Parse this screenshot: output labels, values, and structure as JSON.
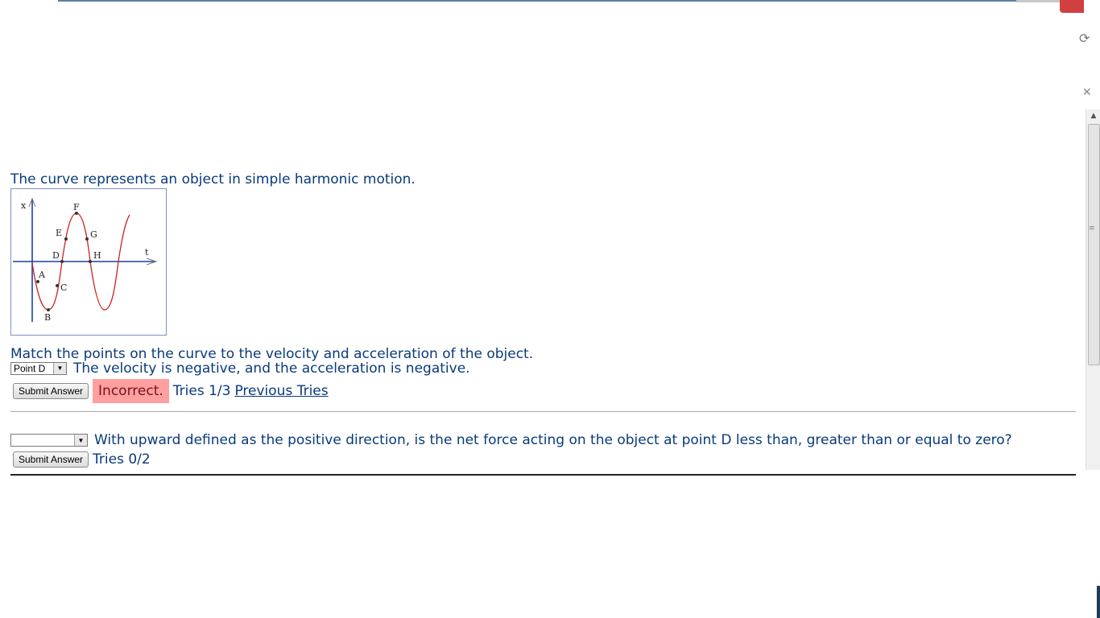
{
  "intro": "The curve represents an object in simple harmonic motion.",
  "figure": {
    "axis_x_label": "x",
    "axis_t_label": "t",
    "points": [
      "A",
      "B",
      "C",
      "D",
      "E",
      "F",
      "G",
      "H"
    ]
  },
  "question1": {
    "prompt": "Match the points on the curve to the velocity and acceleration of the object.",
    "select_value": "Point D",
    "statement": "The velocity is negative, and the acceleration is negative.",
    "submit_label": "Submit Answer",
    "result": "Incorrect.",
    "tries": "Tries 1/3",
    "previous_tries": "Previous Tries"
  },
  "question2": {
    "select_value": "",
    "prompt": "With upward defined as the positive direction, is the net force acting on the object at point D less than, greater than or equal to zero?",
    "submit_label": "Submit Answer",
    "tries": "Tries 0/2"
  },
  "colors": {
    "text": "#0a3a7a",
    "incorrect_bg": "#ff9f9f",
    "curve": "#cc2222",
    "axis": "#1c3fae"
  }
}
